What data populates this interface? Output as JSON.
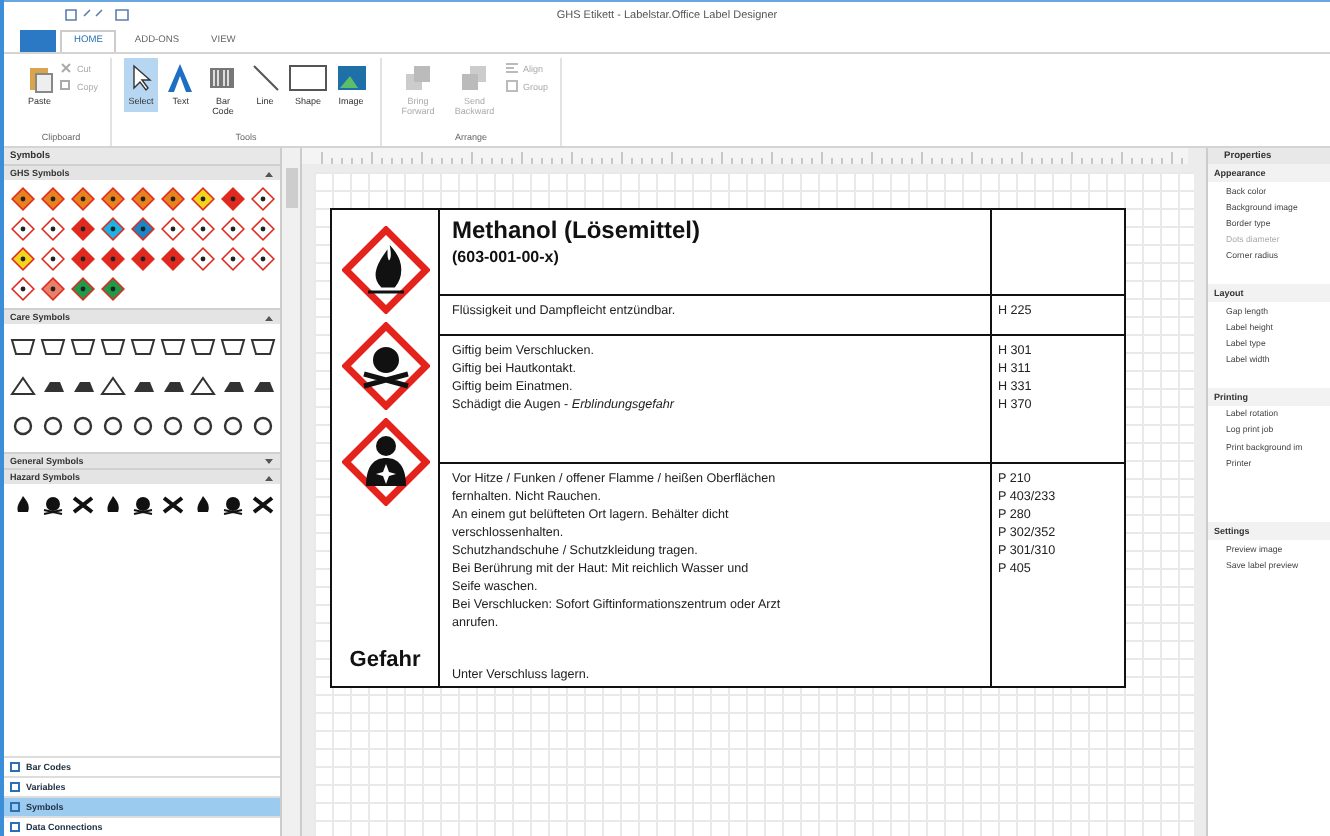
{
  "window": {
    "title": "GHS Etikett - Labelstar.Office Label Designer"
  },
  "ribbon": {
    "tabs": [
      {
        "label": "HOME",
        "selected": true
      },
      {
        "label": "ADD-ONS",
        "selected": false
      },
      {
        "label": "VIEW",
        "selected": false
      }
    ],
    "groups": [
      {
        "label": "Clipboard",
        "buttons": [
          {
            "label": "Paste",
            "kind": "large",
            "disabled": false
          },
          {
            "label": "Cut",
            "kind": "small",
            "disabled": true
          },
          {
            "label": "Copy",
            "kind": "small",
            "disabled": true
          }
        ]
      },
      {
        "label": "Tools",
        "buttons": [
          {
            "label": "Select",
            "kind": "large",
            "selected": true,
            "disabled": false
          },
          {
            "label": "Text",
            "kind": "large",
            "selected": false,
            "disabled": false
          },
          {
            "label": "Bar Code",
            "kind": "large",
            "selected": false,
            "disabled": false
          },
          {
            "label": "Line",
            "kind": "large",
            "selected": false,
            "disabled": false
          },
          {
            "label": "Shape",
            "kind": "large",
            "selected": false,
            "disabled": false
          },
          {
            "label": "Image",
            "kind": "large",
            "selected": false,
            "disabled": false
          }
        ]
      },
      {
        "label": "Arrange",
        "buttons": [
          {
            "label": "Bring Forward",
            "kind": "large",
            "disabled": true
          },
          {
            "label": "Send Backward",
            "kind": "large",
            "disabled": true
          },
          {
            "label": "Align",
            "kind": "small",
            "disabled": true
          },
          {
            "label": "Group",
            "kind": "small",
            "disabled": true
          }
        ]
      }
    ]
  },
  "symbols_panel": {
    "title": "Symbols",
    "sections": [
      {
        "title": "GHS Symbols",
        "kind": "ghs",
        "expanded": true
      },
      {
        "title": "Care Symbols",
        "kind": "care",
        "expanded": true
      },
      {
        "title": "General Symbols",
        "expanded": false
      },
      {
        "title": "Hazard Symbols",
        "kind": "hazard",
        "expanded": true
      }
    ],
    "ghs_symbols": [
      {
        "color": "#e8821e"
      },
      {
        "color": "#e8821e"
      },
      {
        "color": "#e8821e"
      },
      {
        "color": "#e8821e"
      },
      {
        "color": "#e8821e"
      },
      {
        "color": "#e8821e"
      },
      {
        "color": "#f2d51c"
      },
      {
        "color": "#e02a1f"
      },
      {
        "color": "#ffffff"
      },
      {
        "color": "#ffffff"
      },
      {
        "color": "#ffffff"
      },
      {
        "color": "#e02a1f"
      },
      {
        "color": "#1ab3e6"
      },
      {
        "color": "#1a86c8"
      },
      {
        "color": "#ffffff"
      },
      {
        "color": "#ffffff"
      },
      {
        "color": "#ffffff"
      },
      {
        "color": "#ffffff"
      },
      {
        "color": "#f2d51c"
      },
      {
        "color": "#ffffff"
      },
      {
        "color": "#e02a1f"
      },
      {
        "color": "#e02a1f"
      },
      {
        "color": "#e02a1f"
      },
      {
        "color": "#e02a1f"
      },
      {
        "color": "#ffffff"
      },
      {
        "color": "#ffffff"
      },
      {
        "color": "#ffffff"
      },
      {
        "color": "#ffffff"
      },
      {
        "color": "#e8806a"
      },
      {
        "color": "#1f9a4a"
      },
      {
        "color": "#1f9a4a"
      }
    ],
    "nav": [
      {
        "label": "Bar Codes",
        "selected": false
      },
      {
        "label": "Variables",
        "selected": false
      },
      {
        "label": "Symbols",
        "selected": true
      },
      {
        "label": "Data Connections",
        "selected": false
      }
    ]
  },
  "label": {
    "title": "Methanol  (Lösemittel)",
    "subtitle": "(603-001-00-x)",
    "signal_word": "Gefahr",
    "pictograms": [
      {
        "kind": "flame"
      },
      {
        "kind": "skull"
      },
      {
        "kind": "health"
      }
    ],
    "rows": [
      {
        "statements": [
          "Flüssigkeit und Dampfleicht entzündbar."
        ],
        "codes": [
          "H 225"
        ]
      },
      {
        "statements": [
          "Giftig beim Verschlucken.",
          "Giftig bei  Hautkontakt.",
          "Giftig beim Einatmen.",
          "Schädigt die Augen - *Erblindungsgefahr*"
        ],
        "codes": [
          "H 301",
          "H 311",
          "H 331",
          "H 370"
        ]
      },
      {
        "statements": [
          "Vor Hitze / Funken / offener Flamme / heißen Oberflächen",
          "fernhalten. Nicht Rauchen.",
          "An einem gut belüfteten Ort lagern. Behälter dicht",
          "verschlossenhalten.",
          "Schutzhandschuhe / Schutzkleidung tragen.",
          "Bei Berührung mit der Haut: Mit reichlich Wasser und",
          "Seife waschen.",
          "Bei Verschlucken: Sofort Giftinformationszentrum oder Arzt",
          "anrufen."
        ],
        "codes": [
          "P 210",
          "P 403/233",
          "P 280",
          "P 302/352",
          "P 301/310",
          "P 405"
        ],
        "footer": "Unter Verschluss lagern."
      }
    ]
  },
  "properties": {
    "title": "Properties",
    "categories": [
      {
        "title": "Appearance",
        "items": [
          {
            "label": "Back color",
            "disabled": false
          },
          {
            "label": "Background image",
            "disabled": false
          },
          {
            "label": "Border type",
            "disabled": false
          },
          {
            "label": "Dots diameter",
            "disabled": true
          },
          {
            "label": "Corner radius",
            "disabled": false
          }
        ]
      },
      {
        "title": "Layout",
        "items": [
          {
            "label": "Gap length",
            "disabled": false
          },
          {
            "label": "Label height",
            "disabled": false
          },
          {
            "label": "Label type",
            "disabled": false
          },
          {
            "label": "Label width",
            "disabled": false
          }
        ]
      },
      {
        "title": "Printing",
        "items": [
          {
            "label": "Label rotation",
            "disabled": false
          },
          {
            "label": "Log print job",
            "disabled": false
          },
          {
            "label": "Print background im",
            "disabled": false
          },
          {
            "label": "Printer",
            "disabled": false
          }
        ]
      },
      {
        "title": "Settings",
        "items": [
          {
            "label": "Preview image",
            "disabled": false
          },
          {
            "label": "Save label preview",
            "disabled": false
          }
        ]
      }
    ]
  }
}
